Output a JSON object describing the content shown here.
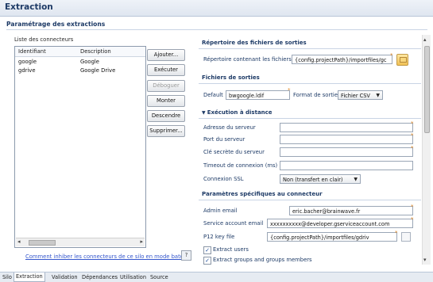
{
  "header": {
    "title": "Extraction"
  },
  "section": {
    "title": "Paramétrage des extractions"
  },
  "connectors": {
    "label": "Liste des connecteurs",
    "columns": [
      "Identifiant",
      "Description"
    ],
    "rows": [
      {
        "id": "google",
        "description": "Google"
      },
      {
        "id": "gdrive",
        "description": "Google Drive"
      }
    ]
  },
  "buttons": {
    "add": "Ajouter...",
    "run": "Exécuter",
    "debug": "Déboguer",
    "up": "Monter",
    "down": "Descendre",
    "delete": "Supprimer..."
  },
  "footer": {
    "link": "Comment inhiber les connecteurs de ce silo en mode batch ?",
    "help_icon": "?"
  },
  "output_dir": {
    "title": "Répertoire des fichiers de sorties",
    "label": "Répertoire contenant les fichiers",
    "value": "{config.projectPath}/importfiles/gc"
  },
  "output_files": {
    "title": "Fichiers de sorties",
    "label": "Default",
    "value": "bwgoogle.ldif",
    "format_label": "Format de sortie",
    "format_value": "Fichier CSV"
  },
  "remote": {
    "title": "Exécution à distance",
    "server_address": "Adresse du serveur",
    "server_port": "Port du serveur",
    "secret_key": "Clé secrète du serveur",
    "timeout": "Timeout de connexion (ms)",
    "ssl_label": "Connexion SSL",
    "ssl_value": "Non (transfert en clair)"
  },
  "connector_params": {
    "title": "Paramètres spécifiques au connecteur",
    "admin_email_label": "Admin email",
    "admin_email_value": "eric.bacher@brainwave.fr",
    "service_label": "Service account email",
    "service_value": "xxxxxxxxxx@developer.gserviceaccount.com",
    "p12_label": "P12 key file",
    "p12_value": "{config.projectPath}/importfiles/gdriv",
    "extract_users": "Extract users",
    "extract_groups": "Extract groups and groups members"
  },
  "bottom_tabs": [
    "Silo",
    "Extraction",
    "Validation",
    "Dépendances",
    "Utilisation",
    "Source"
  ],
  "colors": {
    "title": "#1d3a66",
    "link": "#3355cc",
    "required": "#e08a2a"
  }
}
